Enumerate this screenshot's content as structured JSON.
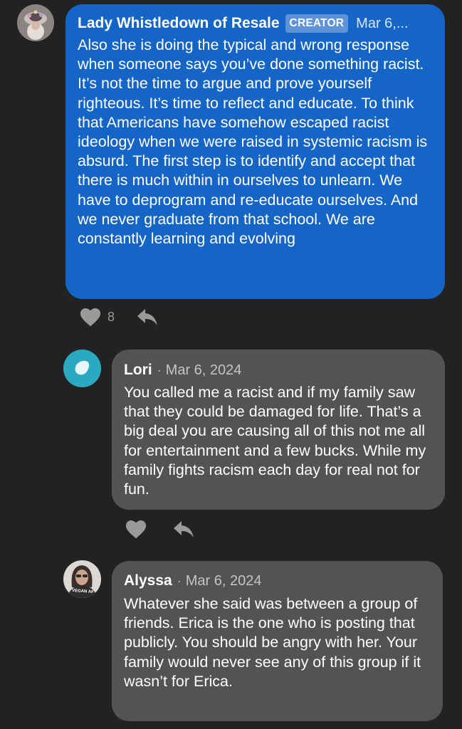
{
  "comments": [
    {
      "author": "Lady Whistledown of Resale",
      "badge": "CREATOR",
      "date": "Mar 6,...",
      "text": "Also she is doing the typical and wrong response when someone says you’ve done something racist. It’s not the time to argue and prove yourself righteous. It’s time to reflect and educate. To think that Americans have somehow escaped racist ideology when we were raised in systemic racism is absurd. The first step is to identify and accept that there is much within in ourselves to unlearn. We have to deprogram and re-educate ourselves. And we never graduate from that school. We are constantly learning and evolving",
      "like_count": "8",
      "bubble_color": "#1565c7"
    },
    {
      "author": "Lori",
      "separator": "·",
      "date": "Mar 6, 2024",
      "text": "You called me a racist and if my family saw that they could be damaged for life. That’s a big deal you are causing all of this not me all for entertainment and a few bucks. While my family fights racism each day for real not for fun.",
      "bubble_color": "#535353"
    },
    {
      "author": "Alyssa",
      "separator": "·",
      "date": "Mar 6, 2024",
      "text": "Whatever she said was between a group of friends. Erica is the one who is posting that publicly. You should be angry with her. Your family would never see any of this group if it wasn’t for Erica.",
      "bubble_color": "#535353",
      "avatar_shirt_text": "VEGAN AF"
    }
  ],
  "icons": {
    "like": "heart-icon",
    "reply": "reply-arrow-icon"
  }
}
